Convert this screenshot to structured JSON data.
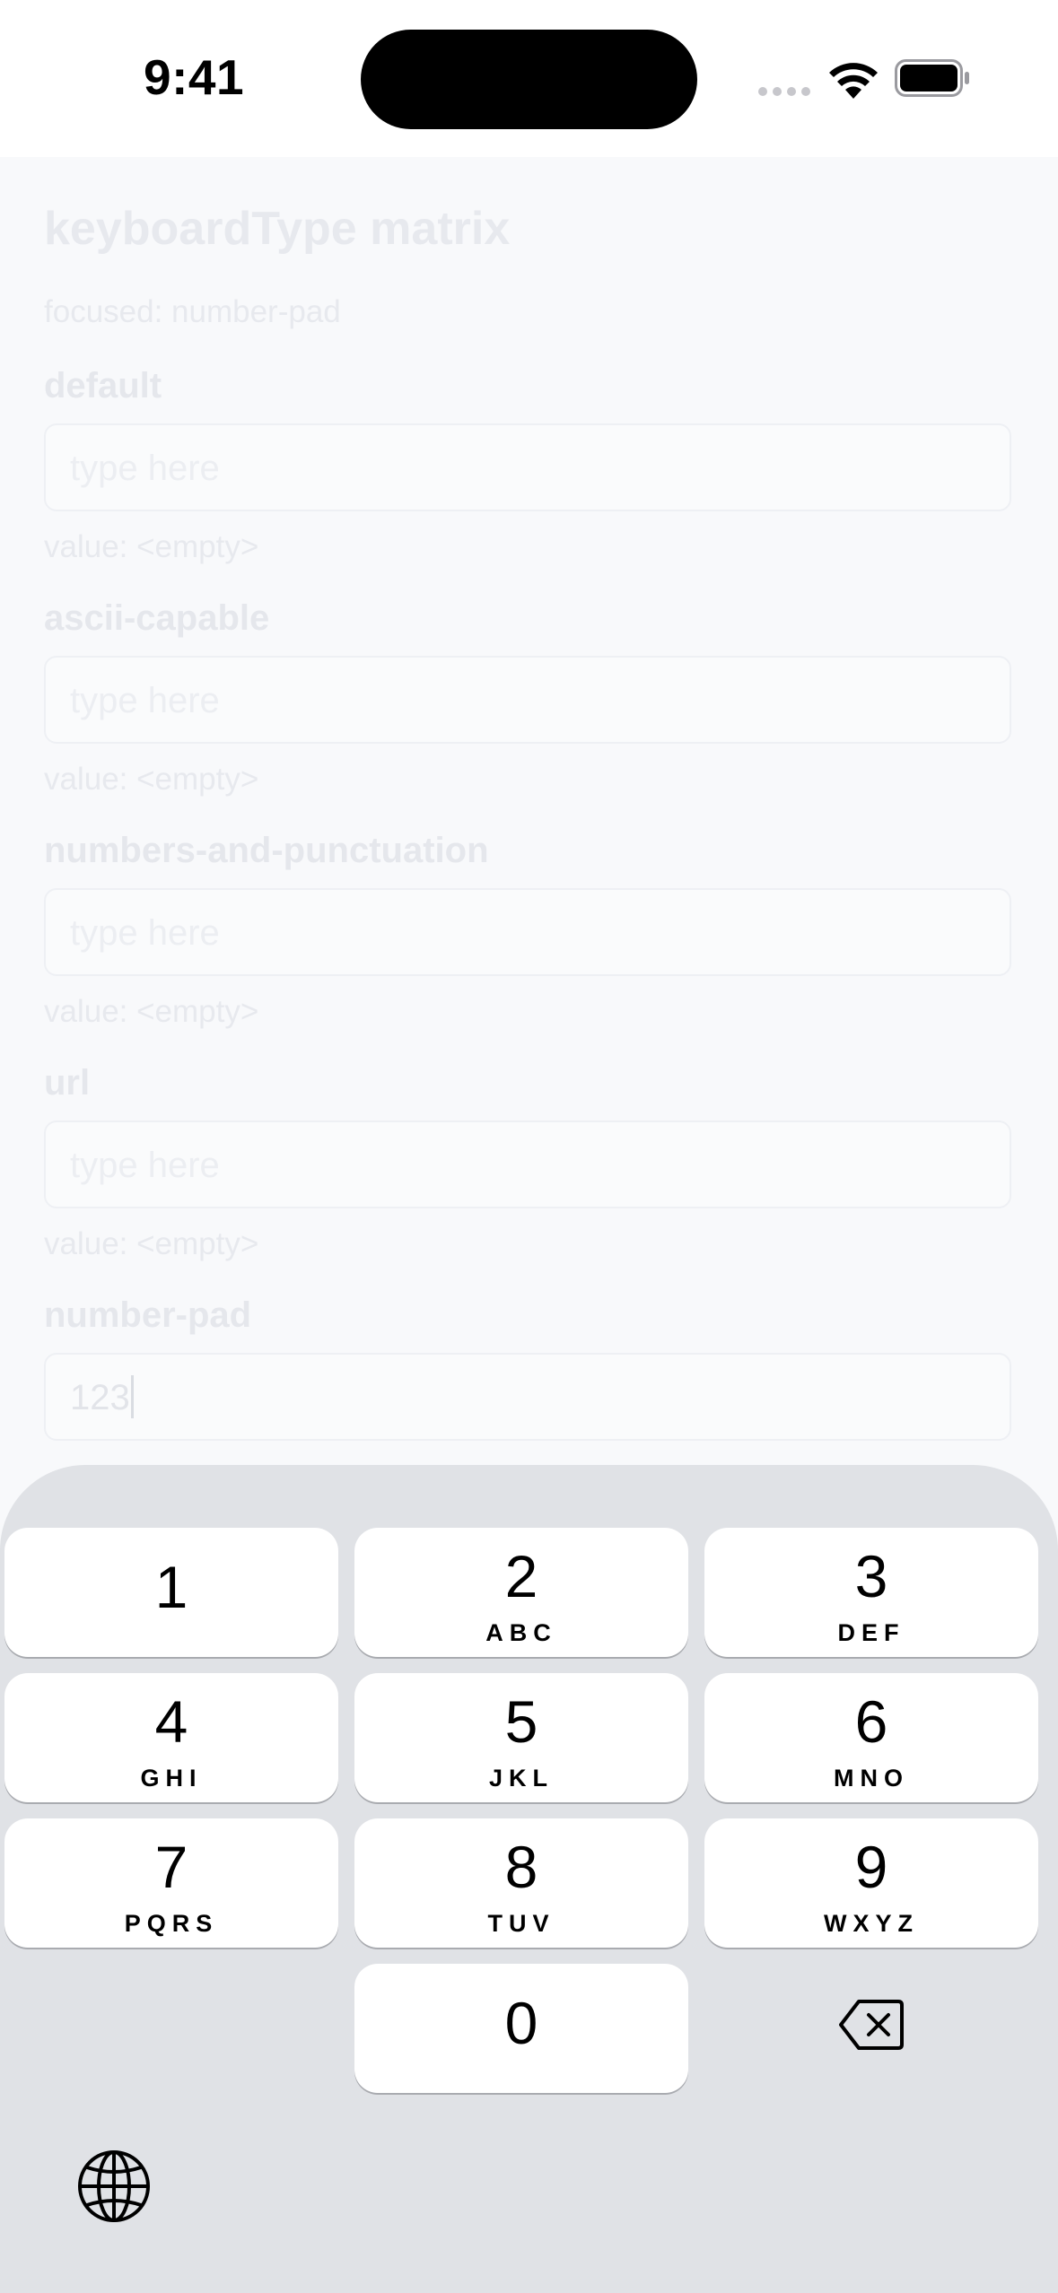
{
  "status_bar": {
    "time": "9:41"
  },
  "screen": {
    "title": "keyboardType matrix",
    "focused_status": "focused: number-pad",
    "fields": [
      {
        "label": "default",
        "placeholder": "type here",
        "value_status": "value: <empty>"
      },
      {
        "label": "ascii-capable",
        "placeholder": "type here",
        "value_status": "value: <empty>"
      },
      {
        "label": "numbers-and-punctuation",
        "placeholder": "type here",
        "value_status": "value: <empty>"
      },
      {
        "label": "url",
        "placeholder": "type here",
        "value_status": "value: <empty>"
      },
      {
        "label": "number-pad",
        "value": "123"
      }
    ]
  },
  "keyboard": {
    "type": "number-pad",
    "keys": [
      {
        "digit": "1",
        "letters": ""
      },
      {
        "digit": "2",
        "letters": "ABC"
      },
      {
        "digit": "3",
        "letters": "DEF"
      },
      {
        "digit": "4",
        "letters": "GHI"
      },
      {
        "digit": "5",
        "letters": "JKL"
      },
      {
        "digit": "6",
        "letters": "MNO"
      },
      {
        "digit": "7",
        "letters": "PQRS"
      },
      {
        "digit": "8",
        "letters": "TUV"
      },
      {
        "digit": "9",
        "letters": "WXYZ"
      },
      {
        "digit": "0",
        "letters": ""
      }
    ],
    "icons": {
      "delete": "delete-backward-icon",
      "globe": "globe-icon"
    }
  }
}
